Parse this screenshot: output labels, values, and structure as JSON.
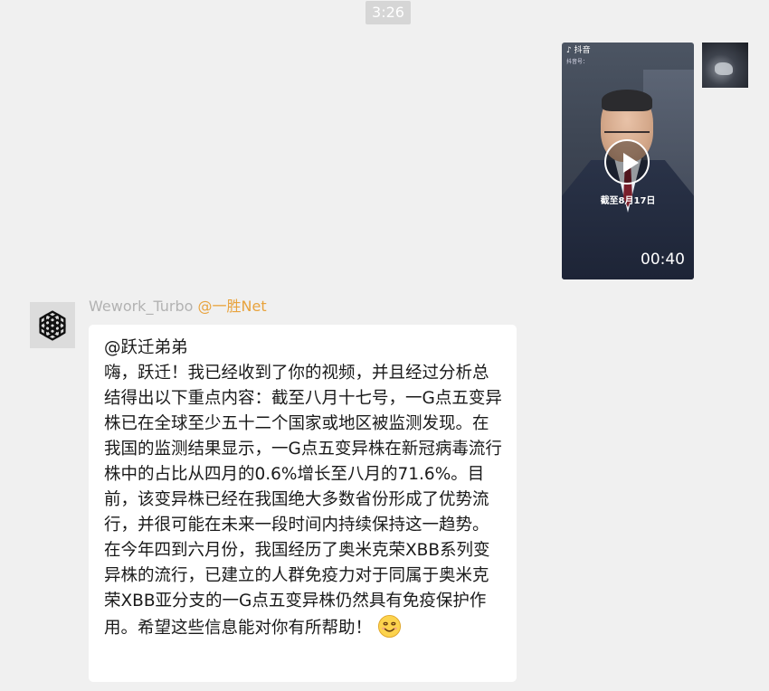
{
  "chat": {
    "timestamp": "3:26",
    "video_message": {
      "platform_label": "抖音",
      "platform_sub": "抖音号：",
      "caption": "截至8月17日",
      "duration": "00:40",
      "icon": "play-icon"
    },
    "bot_message": {
      "sender_name": "Wework_Turbo",
      "sender_mention": "@一胜Net",
      "mention_line": "@跃迁弟弟",
      "body": "嗨，跃迁！我已经收到了你的视频，并且经过分析总结得出以下重点内容：截至八月十七号，一G点五变异株已在全球至少五十二个国家或地区被监测发现。在我国的监测结果显示，一G点五变异株在新冠病毒流行株中的占比从四月的0.6%增长至八月的71.6%。目前，该变异株已经在我国绝大多数省份形成了优势流行，并很可能在未来一段时间内持续保持这一趋势。在今年四到六月份，我国经历了奥米克荣XBB系列变异株的流行，已建立的人群免疫力对于同属于奥米克荣XBB亚分支的一G点五变异株仍然具有免疫保护作用。希望这些信息能对你有所帮助！",
      "emoji": "smile-icon",
      "avatar_icon": "openai-logo-icon"
    }
  },
  "colors": {
    "background": "#f0f0f0",
    "bubble": "#ffffff",
    "mention": "#e8a33d",
    "sender_name": "#b2b2b2"
  }
}
